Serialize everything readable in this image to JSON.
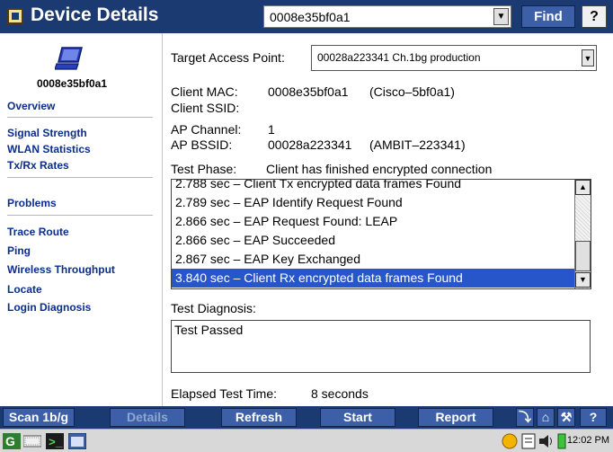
{
  "title": "Device Details",
  "header": {
    "device_value": "0008e35bf0a1",
    "find_label": "Find",
    "help_glyph": "?",
    "icons": [
      "app-logo-icon",
      "dropdown-arrow-icon",
      "help-pointer-icon"
    ]
  },
  "sidebar": {
    "device_name": "0008e35bf0a1",
    "device_icon": "laptop-icon",
    "links": [
      {
        "label": "Overview"
      },
      {
        "label": "Signal Strength"
      },
      {
        "label": "WLAN Statistics"
      },
      {
        "label": "Tx/Rx Rates"
      },
      {
        "label": "Problems"
      },
      {
        "label": "Trace Route"
      },
      {
        "label": "Ping"
      },
      {
        "label": "Wireless Throughput"
      },
      {
        "label": "Locate"
      },
      {
        "label": "Login Diagnosis"
      }
    ]
  },
  "main": {
    "target_ap_label": "Target Access Point:",
    "target_ap_value": "00028a223341 Ch.1bg  production",
    "client_mac_label": "Client MAC:",
    "client_mac_value": "0008e35bf0a1",
    "client_mac_vendor": "(Cisco–5bf0a1)",
    "client_ssid_label": "Client SSID:",
    "ap_channel_label": "AP Channel:",
    "ap_channel_value": "1",
    "ap_bssid_label": "AP BSSID:",
    "ap_bssid_value": "00028a223341",
    "ap_bssid_vendor": "(AMBIT–223341)",
    "test_phase_label": "Test Phase:",
    "test_phase_value": "Client has finished encrypted connection",
    "log": [
      "2.788 sec – Client Tx encrypted data frames Found",
      "2.789 sec – EAP Identify Request Found",
      "2.866 sec – EAP Request Found: LEAP",
      "2.866 sec – EAP Succeeded",
      "2.867 sec – EAP Key Exchanged",
      "3.840 sec – Client Rx encrypted data frames Found"
    ],
    "test_diagnosis_label": "Test Diagnosis:",
    "test_diagnosis_value": "Test Passed",
    "elapsed_label": "Elapsed Test Time:",
    "elapsed_value": "8 seconds"
  },
  "toolbar": {
    "scan_label": "Scan 1b/g",
    "details_label": "Details",
    "refresh_label": "Refresh",
    "start_label": "Start",
    "report_label": "Report",
    "icons": [
      "exit-icon",
      "home-icon",
      "tools-icon",
      "help-icon"
    ],
    "help_glyph": "?"
  },
  "taskbar": {
    "clock": "12:02 PM",
    "icons": [
      "start-icon",
      "keyboard-icon",
      "terminal-icon",
      "window-icon",
      "network-icon",
      "clipboard-icon",
      "speaker-icon",
      "battery-icon"
    ]
  },
  "colors": {
    "titlebar": "#1c3a72",
    "button": "#3c5fa8",
    "link": "#0b2d8c",
    "selection": "#2656c9"
  }
}
